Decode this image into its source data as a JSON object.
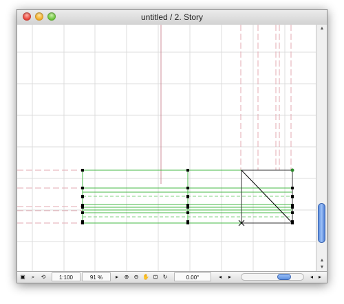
{
  "window": {
    "title": "untitled / 2. Story"
  },
  "statusbar": {
    "scale": "1:100",
    "zoom": "91 %",
    "angle": "0.00°",
    "icons": [
      "layer-icon",
      "magnify-icon",
      "rebuild-icon",
      "zoom-in-icon",
      "zoom-out-icon",
      "pan-icon",
      "fit-window-icon",
      "rotate-icon",
      "previous-zoom-icon",
      "next-zoom-icon"
    ]
  },
  "colors": {
    "grid": "#d9d9d9",
    "dashed": "#e4a9b1",
    "green": "#3ab53a",
    "element": "#000000"
  }
}
